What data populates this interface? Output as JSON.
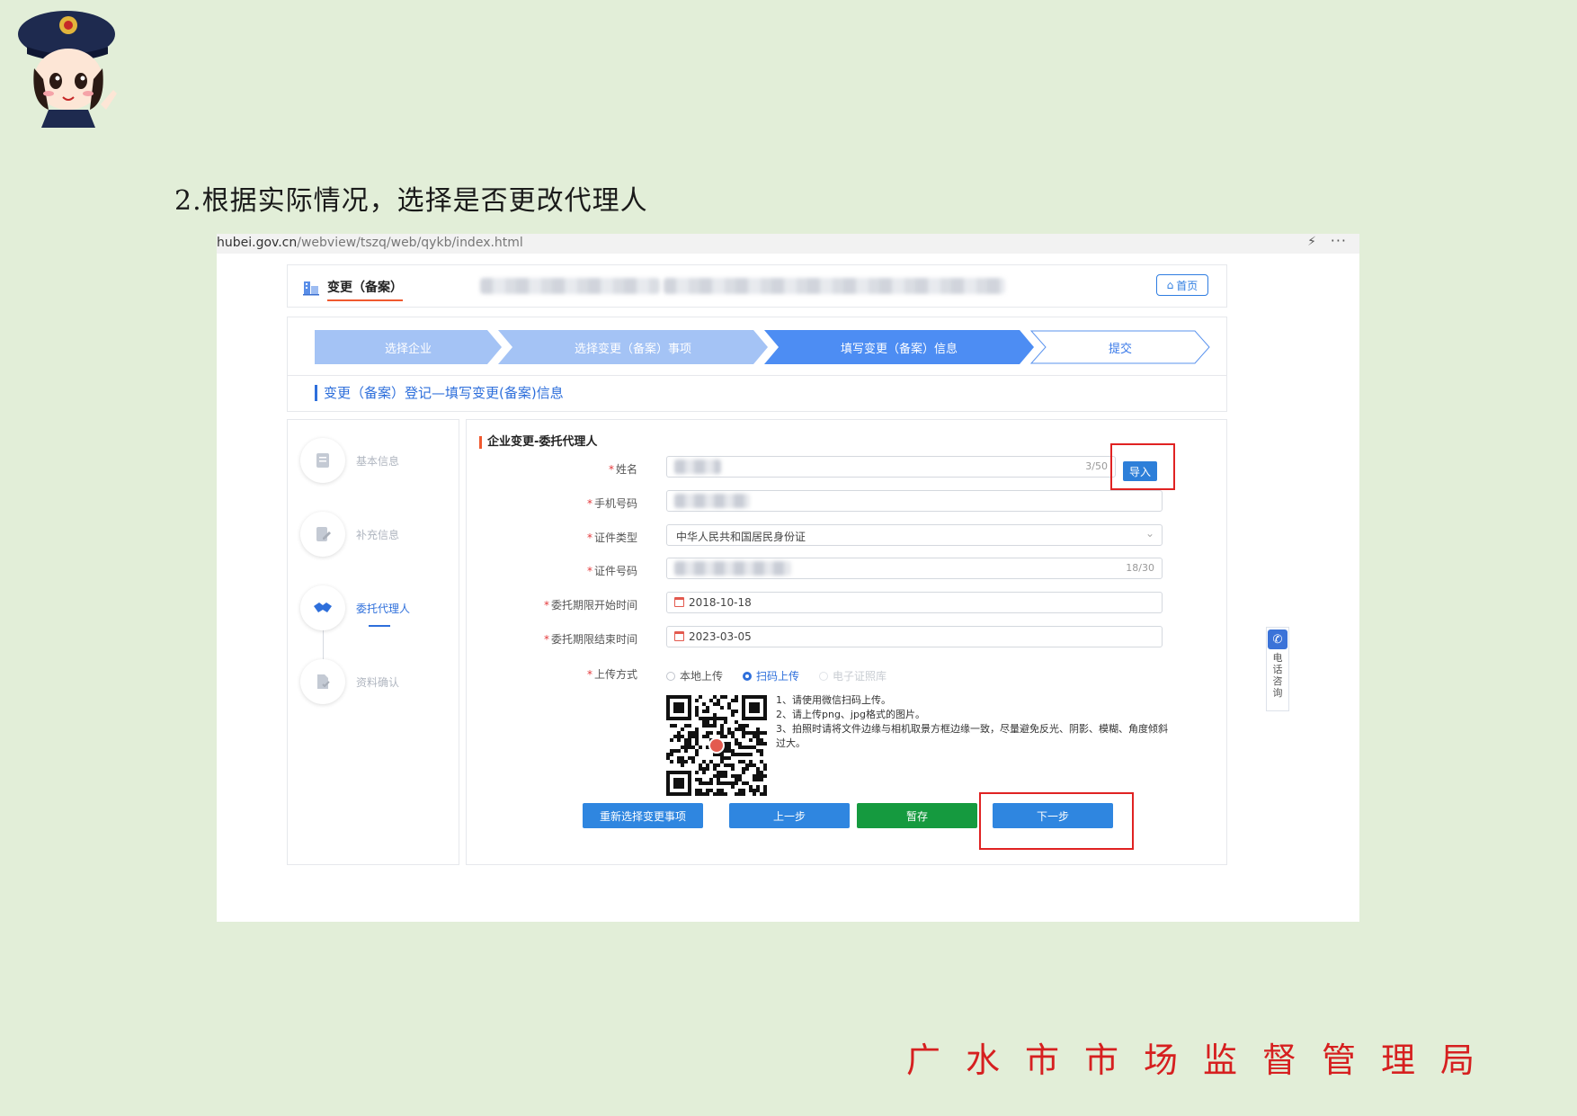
{
  "doc": {
    "title": "2.根据实际情况，选择是否更改代理人",
    "footer": "广水市市场监督管理局"
  },
  "browser": {
    "url_host": "hubei.gov.cn",
    "url_path": "/webview/tszq/web/qykb/index.html"
  },
  "header": {
    "title": "变更（备案）",
    "home_label": "首页"
  },
  "steps": [
    {
      "label": "选择企业",
      "state": "done"
    },
    {
      "label": "选择变更（备案）事项",
      "state": "done"
    },
    {
      "label": "填写变更（备案）信息",
      "state": "active"
    },
    {
      "label": "提交",
      "state": "pending"
    }
  ],
  "subheader": {
    "title": "变更（备案）登记—填写变更(备案)信息"
  },
  "sidenav": [
    {
      "label": "基本信息",
      "icon": "document-icon",
      "active": false
    },
    {
      "label": "补充信息",
      "icon": "edit-document-icon",
      "active": false
    },
    {
      "label": "委托代理人",
      "icon": "handshake-icon",
      "active": true
    },
    {
      "label": "资料确认",
      "icon": "file-check-icon",
      "active": false
    }
  ],
  "form": {
    "section_title": "企业变更-委托代理人",
    "required_mark": "*",
    "name": {
      "label": "姓名",
      "count": "3/50",
      "import_label": "导入"
    },
    "phone": {
      "label": "手机号码"
    },
    "id_type": {
      "label": "证件类型",
      "value": "中华人民共和国居民身份证"
    },
    "id_number": {
      "label": "证件号码",
      "count": "18/30"
    },
    "start_date": {
      "label": "委托期限开始时间",
      "value": "2018-10-18"
    },
    "end_date": {
      "label": "委托期限结束时间",
      "value": "2023-03-05"
    },
    "upload": {
      "label": "上传方式",
      "options": [
        {
          "label": "本地上传",
          "selected": false,
          "disabled": false
        },
        {
          "label": "扫码上传",
          "selected": true,
          "disabled": false
        },
        {
          "label": "电子证照库",
          "selected": false,
          "disabled": true
        }
      ],
      "notes": [
        "1、请使用微信扫码上传。",
        "2、请上传png、jpg格式的图片。",
        "3、拍照时请将文件边缘与相机取景方框边缘一致，尽量避免反光、阴影、模糊、角度倾斜过大。"
      ]
    }
  },
  "buttons": {
    "reselect": "重新选择变更事项",
    "prev": "上一步",
    "save": "暂存",
    "next": "下一步"
  },
  "phone_widget": {
    "label": "电话咨询"
  },
  "colors": {
    "primary": "#2f86e0",
    "save_green": "#159a3f",
    "highlight_red": "#e02222",
    "step_done": "#a4c3f5",
    "step_active": "#4d8df3",
    "page_bg": "#e2eed8"
  }
}
